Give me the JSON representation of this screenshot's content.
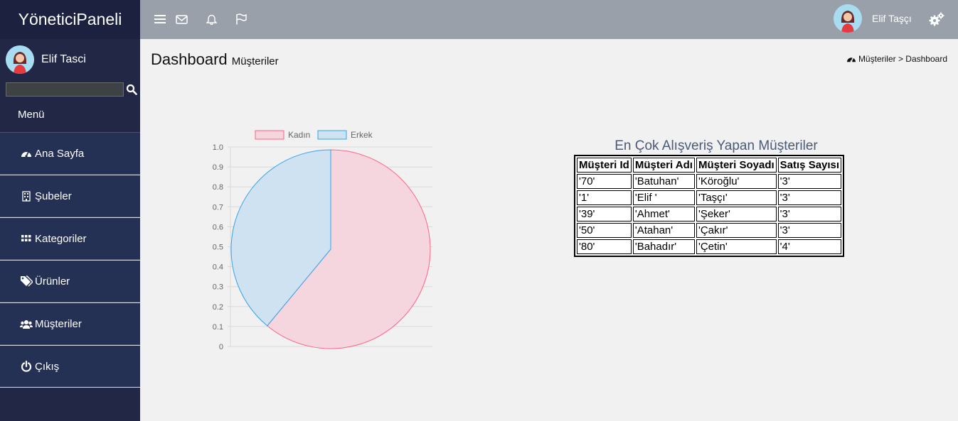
{
  "app": {
    "brand": "YöneticiPaneli"
  },
  "sidebar": {
    "user_name": "Elif Tasci",
    "search": {
      "value": "",
      "placeholder": ""
    },
    "menu_title": "Menü",
    "items": [
      {
        "label": "Ana Sayfa",
        "icon": "dashboard-icon"
      },
      {
        "label": "Şubeler",
        "icon": "building-icon"
      },
      {
        "label": "Kategoriler",
        "icon": "grid-icon"
      },
      {
        "label": "Ürünler",
        "icon": "tags-icon"
      },
      {
        "label": "Müşteriler",
        "icon": "users-icon"
      },
      {
        "label": "Çıkış",
        "icon": "power-icon"
      }
    ]
  },
  "topbar": {
    "icons": [
      "menu-icon",
      "mail-icon",
      "bell-icon",
      "flag-icon"
    ],
    "user_name": "Elif Taşçı",
    "settings_icon": "gears-icon"
  },
  "header": {
    "title": "Dashboard",
    "subtitle": "Müşteriler",
    "breadcrumb": "Müşteriler > Dashboard"
  },
  "chart_data": {
    "type": "pie",
    "labels": [
      "Kadın",
      "Erkek"
    ],
    "values": [
      0.61,
      0.39
    ],
    "colors": {
      "fill": [
        "#f6d6de",
        "#cfe2f1"
      ],
      "border": [
        "#ff6384",
        "#36a2eb"
      ]
    },
    "y_ticks": [
      "1.0",
      "0.9",
      "0.8",
      "0.7",
      "0.6",
      "0.5",
      "0.4",
      "0.3",
      "0.2",
      "0.1",
      "0"
    ],
    "legend": "top",
    "grid": true
  },
  "customers_table": {
    "title": "En Çok Alışveriş Yapan Müşteriler",
    "headers": [
      "Müşteri Id",
      "Müşteri Adı",
      "Müşteri Soyadı",
      "Satış Sayısı"
    ],
    "rows": [
      [
        "'70'",
        "'Batuhan'",
        "'Köroğlu'",
        "'3'"
      ],
      [
        "'1'",
        "'Elif '",
        "'Taşçı'",
        "'3'"
      ],
      [
        "'39'",
        "'Ahmet'",
        "'Şeker'",
        "'3'"
      ],
      [
        "'50'",
        "'Atahan'",
        "'Çakır'",
        "'3'"
      ],
      [
        "'80'",
        "'Bahadır'",
        "'Çetin'",
        "'4'"
      ]
    ]
  }
}
